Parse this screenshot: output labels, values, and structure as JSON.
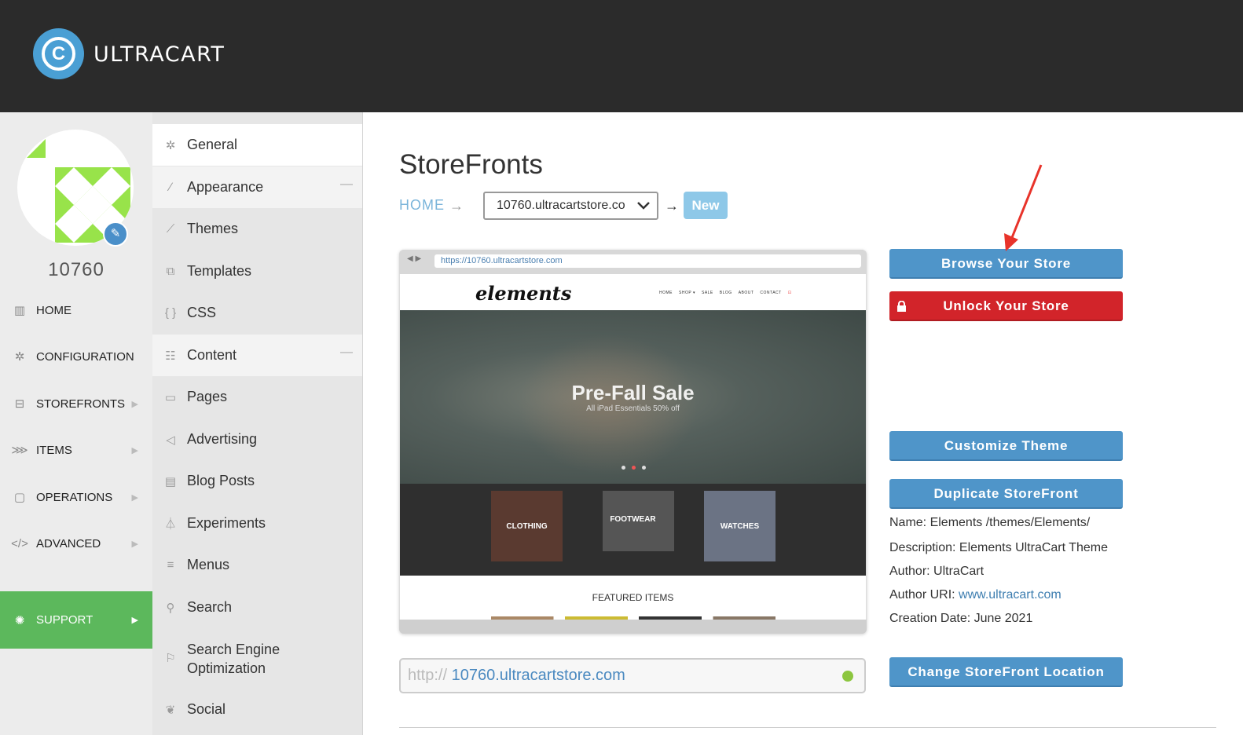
{
  "header": {
    "brand": "ULTRACART",
    "logo_glyph": "C"
  },
  "account": {
    "id": "10760"
  },
  "leftnav": [
    {
      "label": "HOME",
      "icon": "bar-chart-icon",
      "glyph": "▥",
      "arrow": false
    },
    {
      "label": "CONFIGURATION",
      "icon": "gear-icon",
      "glyph": "✲",
      "arrow": false
    },
    {
      "label": "STOREFRONTS",
      "icon": "cart-icon",
      "glyph": "⊟",
      "arrow": true
    },
    {
      "label": "ITEMS",
      "icon": "tags-icon",
      "glyph": "⋙",
      "arrow": true
    },
    {
      "label": "OPERATIONS",
      "icon": "clipboard-icon",
      "glyph": "▢",
      "arrow": true
    },
    {
      "label": "ADVANCED",
      "icon": "code-icon",
      "glyph": "</>",
      "arrow": true
    },
    {
      "label": "SUPPORT",
      "icon": "lightbulb-icon",
      "glyph": "✺",
      "arrow": true
    }
  ],
  "subnav": [
    {
      "label": "General",
      "icon": "gear-icon",
      "glyph": "✲",
      "type": "hdr active"
    },
    {
      "label": "Appearance",
      "icon": "brush-icon",
      "glyph": "∕",
      "type": "hdr",
      "collapse": "—"
    },
    {
      "label": "Themes",
      "icon": "dropper-icon",
      "glyph": "⟋",
      "type": ""
    },
    {
      "label": "Templates",
      "icon": "templates-icon",
      "glyph": "⧉",
      "type": ""
    },
    {
      "label": "CSS",
      "icon": "braces-icon",
      "glyph": "{ }",
      "type": ""
    },
    {
      "label": "Content",
      "icon": "list-icon",
      "glyph": "☷",
      "type": "hdr",
      "collapse": "—"
    },
    {
      "label": "Pages",
      "icon": "page-icon",
      "glyph": "▭",
      "type": ""
    },
    {
      "label": "Advertising",
      "icon": "megaphone-icon",
      "glyph": "◁",
      "type": ""
    },
    {
      "label": "Blog Posts",
      "icon": "document-icon",
      "glyph": "▤",
      "type": ""
    },
    {
      "label": "Experiments",
      "icon": "flask-icon",
      "glyph": "⏃",
      "type": ""
    },
    {
      "label": "Menus",
      "icon": "menu-icon",
      "glyph": "≡",
      "type": ""
    },
    {
      "label": "Search",
      "icon": "search-icon",
      "glyph": "⚲",
      "type": ""
    },
    {
      "label": "Search Engine Optimization",
      "icon": "flag-icon",
      "glyph": "⚐",
      "type": "two"
    },
    {
      "label": "Social",
      "icon": "bird-icon",
      "glyph": "❦",
      "type": ""
    }
  ],
  "main": {
    "title": "StoreFronts",
    "breadcrumb_home": "HOME",
    "breadcrumb_arrow": "→",
    "store_select": "10760.ultracartstore.co",
    "new_label": "New"
  },
  "preview": {
    "url": "https://10760.ultracartstore.com",
    "brand": "elements",
    "menu": [
      "HOME",
      "SHOP ▾",
      "SALE",
      "BLOG",
      "ABOUT",
      "CONTACT"
    ],
    "hero_title": "Pre-Fall Sale",
    "hero_sub": "All iPad Essentials 50% off",
    "categories": [
      "CLOTHING",
      "FOOTWEAR",
      "WATCHES"
    ],
    "featured": "FEATURED ITEMS"
  },
  "url_bar": {
    "protocol": "http://",
    "host": "10760.ultracartstore.com"
  },
  "buttons": {
    "browse": "Browse Your Store",
    "unlock": "Unlock Your Store",
    "customize": "Customize Theme",
    "duplicate": "Duplicate StoreFront",
    "change_location": "Change StoreFront Location"
  },
  "theme_meta": {
    "name": "Name: Elements /themes/Elements/",
    "description": "Description: Elements UltraCart Theme",
    "author": "Author: UltraCart",
    "author_uri_label": "Author URI:",
    "author_uri": "www.ultracart.com",
    "creation_date": "Creation Date: June 2021"
  },
  "colors": {
    "accent_blue": "#4f95c9",
    "danger_red": "#d2242a",
    "support_green": "#5cb85c",
    "header_bg": "#2b2b2b"
  }
}
